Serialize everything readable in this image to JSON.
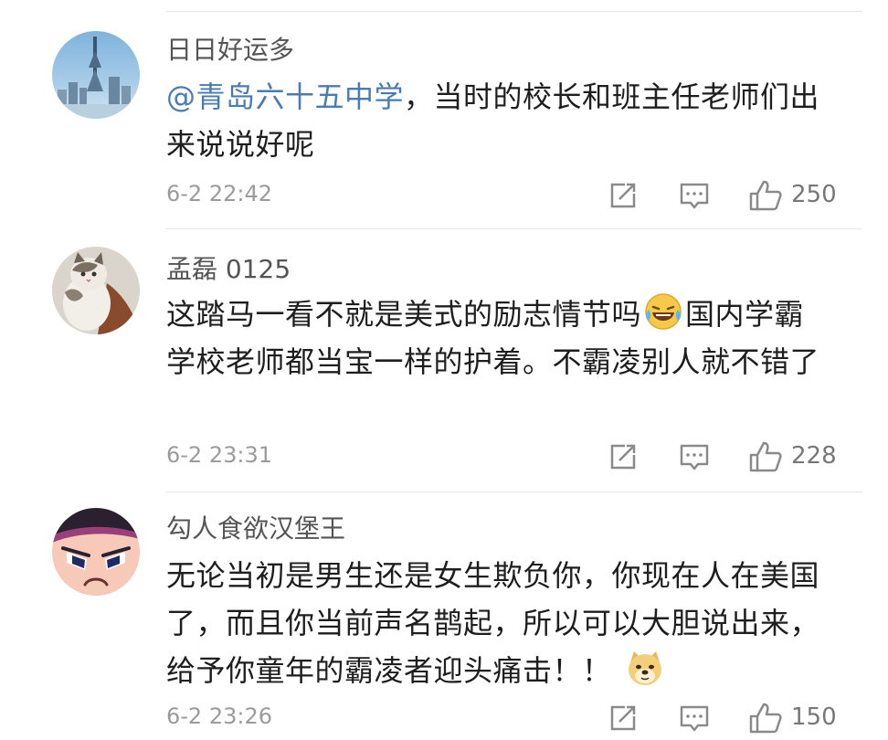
{
  "comments": [
    {
      "username": "日日好运多",
      "mention": "@青岛六十五中学",
      "text": "，当时的校长和班主任老师们出来说说好呢",
      "time": "6-2 22:42",
      "likes": "250",
      "avatar": "city-tower-avatar"
    },
    {
      "username": "孟磊 0125",
      "text_before_emoji": "这踏马一看不就是美式的励志情节吗",
      "emoji": "laugh-cry-emoji",
      "text_after_emoji": "国内学霸学校老师都当宝一样的护着。不霸凌别人就不错了",
      "time": "6-2 23:31",
      "likes": "228",
      "avatar": "cat-avatar"
    },
    {
      "username": "勾人食欲汉堡王",
      "text": "无论当初是男生还是女生欺负你，你现在人在美国了，而且你当前声名鹊起，所以可以大胆说出来，给予你童年的霸凌者迎头痛击！！",
      "emoji": "doge-emoji",
      "time": "6-2 23:26",
      "likes": "150",
      "avatar": "angry-cartoon-avatar"
    }
  ],
  "colors": {
    "mention": "#4a7bb7",
    "meta": "#9b9b9b",
    "divider": "#e6e6e6"
  }
}
